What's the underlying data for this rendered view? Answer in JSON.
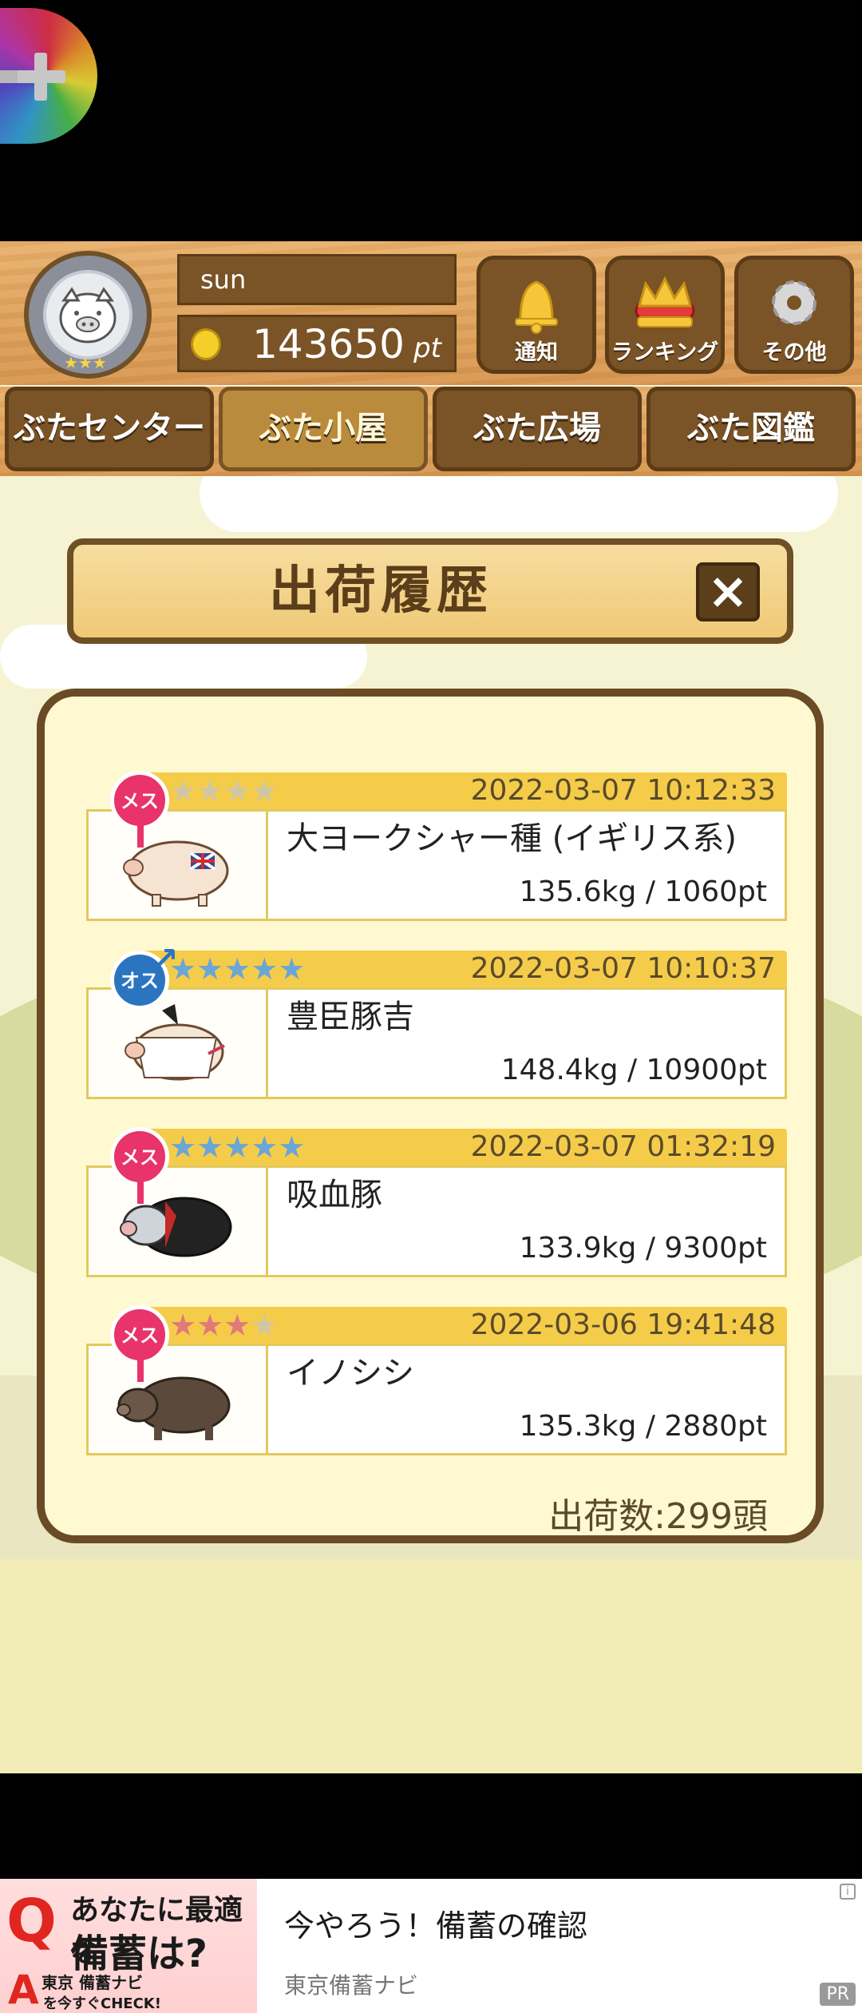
{
  "header": {
    "username": "sun",
    "points_value": "143650",
    "points_unit": "pt",
    "buttons": [
      {
        "label": "通知",
        "icon": "bell-icon"
      },
      {
        "label": "ランキング",
        "icon": "crown-icon"
      },
      {
        "label": "その他",
        "icon": "gear-icon"
      }
    ]
  },
  "tabs": [
    {
      "label": "ぶたセンター",
      "active": false
    },
    {
      "label": "ぶた小屋",
      "active": true
    },
    {
      "label": "ぶた広場",
      "active": false
    },
    {
      "label": "ぶた図鑑",
      "active": false
    }
  ],
  "dialog": {
    "title": "出荷履歴",
    "close_label": "×",
    "ship_count": "出荷数:299頭"
  },
  "entries": [
    {
      "gender_label": "メス",
      "gender": "female",
      "stars_filled": 1,
      "stars_total": 5,
      "star_color": "red",
      "datetime": "2022-03-07 10:12:33",
      "name": "大ヨークシャー種 (イギリス系)",
      "stat": "135.6kg / 1060pt"
    },
    {
      "gender_label": "オス",
      "gender": "male",
      "stars_filled": 6,
      "stars_total": 6,
      "star_color": "blue",
      "datetime": "2022-03-07 10:10:37",
      "name": "豊臣豚吉",
      "stat": "148.4kg / 10900pt"
    },
    {
      "gender_label": "メス",
      "gender": "female",
      "stars_filled": 6,
      "stars_total": 6,
      "star_color": "blue",
      "datetime": "2022-03-07 01:32:19",
      "name": "吸血豚",
      "stat": "133.9kg / 9300pt"
    },
    {
      "gender_label": "メス",
      "gender": "female",
      "stars_filled": 4,
      "stars_total": 5,
      "star_color": "red",
      "datetime": "2022-03-06 19:41:48",
      "name": "イノシシ",
      "stat": "135.3kg / 2880pt"
    }
  ],
  "ad": {
    "image_q": "Q",
    "image_line1": "あなたに最適な",
    "image_line2": "備蓄は?",
    "image_a": "A",
    "image_small1": "東京 備蓄ナビ",
    "image_small2": "を今すぐCHECK!",
    "headline": "今やろう！備蓄の確認",
    "source": "東京備蓄ナビ",
    "pr_label": "PR",
    "info_label": "i"
  },
  "colors": {
    "wood": "#d7964f",
    "wood_dark": "#7a5326",
    "panel_bg": "#fff9d2",
    "entry_header": "#f5cc4a",
    "female": "#e8336b",
    "male": "#2b75c0"
  }
}
